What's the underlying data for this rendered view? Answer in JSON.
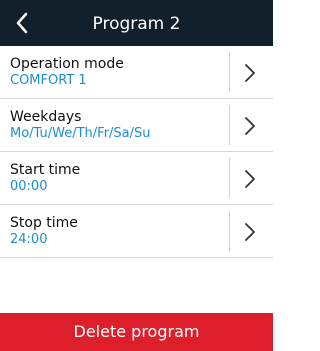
{
  "header": {
    "title": "Program 2",
    "back_icon": "chevron-left-icon"
  },
  "rows": [
    {
      "label": "Operation mode",
      "value": "COMFORT 1"
    },
    {
      "label": "Weekdays",
      "value": "Mo/Tu/We/Th/Fr/Sa/Su"
    },
    {
      "label": "Start time",
      "value": "00:00"
    },
    {
      "label": "Stop time",
      "value": "24:00"
    }
  ],
  "row_icon": "chevron-right-icon",
  "footer": {
    "delete_label": "Delete program"
  },
  "colors": {
    "header_bg": "#12202b",
    "accent_value": "#1a8fcf",
    "delete_bg": "#dc1f2a"
  }
}
